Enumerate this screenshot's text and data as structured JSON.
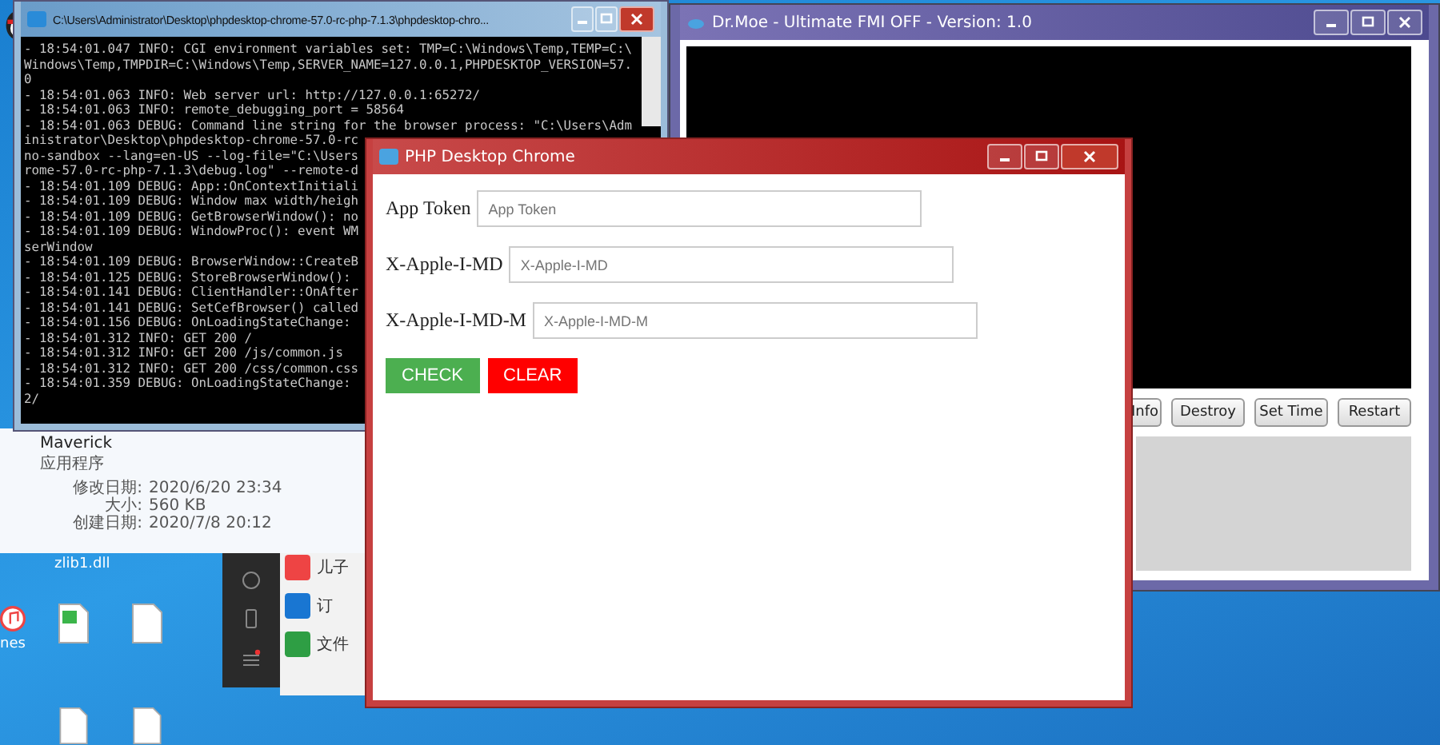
{
  "console_window": {
    "title": "C:\\Users\\Administrator\\Desktop\\phpdesktop-chrome-57.0-rc-php-7.1.3\\phpdesktop-chro...",
    "lines": [
      "- 18:54:01.047 INFO: CGI environment variables set: TMP=C:\\Windows\\Temp,TEMP=C:\\",
      "Windows\\Temp,TMPDIR=C:\\Windows\\Temp,SERVER_NAME=127.0.0.1,PHPDESKTOP_VERSION=57.",
      "0",
      "- 18:54:01.063 INFO: Web server url: http://127.0.0.1:65272/",
      "- 18:54:01.063 INFO: remote_debugging_port = 58564",
      "- 18:54:01.063 DEBUG: Command line string for the browser process: \"C:\\Users\\Adm",
      "inistrator\\Desktop\\phpdesktop-chrome-57.0-rc",
      "no-sandbox --lang=en-US --log-file=\"C:\\Users",
      "rome-57.0-rc-php-7.1.3\\debug.log\" --remote-d",
      "- 18:54:01.109 DEBUG: App::OnContextInitiali",
      "- 18:54:01.109 DEBUG: Window max width/heigh",
      "- 18:54:01.109 DEBUG: GetBrowserWindow(): no",
      "- 18:54:01.109 DEBUG: WindowProc(): event WM",
      "serWindow",
      "- 18:54:01.109 DEBUG: BrowserWindow::CreateB",
      "- 18:54:01.125 DEBUG: StoreBrowserWindow():",
      "- 18:54:01.141 DEBUG: ClientHandler::OnAfter",
      "- 18:54:01.141 DEBUG: SetCefBrowser() called",
      "- 18:54:01.156 DEBUG: OnLoadingStateChange:",
      "- 18:54:01.312 INFO: GET 200 /",
      "- 18:54:01.312 INFO: GET 200 /js/common.js",
      "- 18:54:01.312 INFO: GET 200 /css/common.css",
      "- 18:54:01.359 DEBUG: OnLoadingStateChange:",
      "2/"
    ]
  },
  "moe_window": {
    "title": "Dr.Moe - Ultimate FMI OFF - Version: 1.0",
    "buttons": [
      "Info",
      "Destroy",
      "Set Time",
      "Restart"
    ]
  },
  "file_info": {
    "name": "Maverick",
    "type": "应用程序",
    "fields": [
      {
        "label": "修改日期:",
        "value": "2020/6/20 23:34"
      },
      {
        "label": "大小:",
        "value": "560 KB"
      },
      {
        "label": "创建日期:",
        "value": "2020/7/8 20:12"
      }
    ]
  },
  "desktop_icons": [
    {
      "label": "zlib1.dll"
    },
    {
      "label": "nes"
    }
  ],
  "side_list": [
    "儿子",
    "订",
    "文件"
  ],
  "php_window": {
    "title": "PHP Desktop Chrome",
    "fields": [
      {
        "label": "App Token",
        "placeholder": "App Token"
      },
      {
        "label": "X-Apple-I-MD",
        "placeholder": "X-Apple-I-MD"
      },
      {
        "label": "X-Apple-I-MD-M",
        "placeholder": "X-Apple-I-MD-M"
      }
    ],
    "buttons": [
      {
        "label": "CHECK",
        "kind": "primary"
      },
      {
        "label": "CLEAR",
        "kind": "danger"
      }
    ]
  }
}
